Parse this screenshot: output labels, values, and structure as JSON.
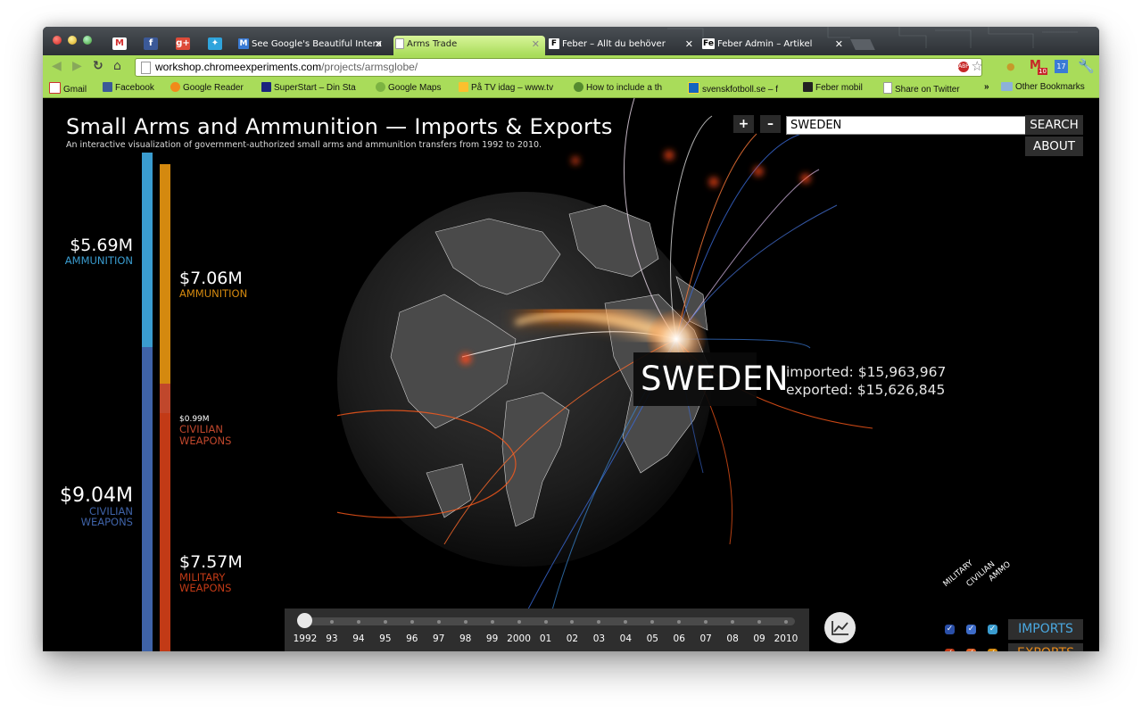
{
  "browser": {
    "tabs": [
      {
        "label": "See Google's Beautiful Intera",
        "favicon": "M"
      },
      {
        "label": "Arms Trade",
        "active": true
      },
      {
        "label": "Feber – Allt du behöver",
        "favicon": "F"
      },
      {
        "label": "Feber Admin – Artikel",
        "favicon": "Fe"
      }
    ],
    "url_host": "workshop.chromeexperiments.com",
    "url_path": "/projects/armsglobe/",
    "gmail_count": "10",
    "calendar_day": "17",
    "abp_label": "ABP",
    "bookmarks": [
      "Gmail",
      "Facebook",
      "Google Reader",
      "SuperStart – Din Sta",
      "Google Maps",
      "På TV idag – www.tv",
      "How to include a th",
      "svenskfotboll.se – f",
      "Feber mobil",
      "Share on Twitter"
    ],
    "bookmarks_overflow": "»",
    "other_bookmarks": "Other Bookmarks"
  },
  "page": {
    "title": "Small Arms and Ammunition — Imports & Exports",
    "subtitle": "An interactive visualization of government-authorized small arms and ammunition transfers from 1992 to 2010.",
    "search_value": "SWEDEN",
    "search_button": "SEARCH",
    "about_button": "ABOUT",
    "zoom_in": "+",
    "zoom_out": "–"
  },
  "imports_bar": {
    "ammunition_value": "$5.69M",
    "ammunition_label": "AMMUNITION",
    "civilian_value": "$9.04M",
    "civilian_label_1": "CIVILIAN",
    "civilian_label_2": "WEAPONS",
    "ammunition_fraction": 0.39,
    "civilian_fraction": 0.61
  },
  "exports_bar": {
    "ammunition_value": "$7.06M",
    "ammunition_label": "AMMUNITION",
    "civilian_value": "$0.99M",
    "civilian_label_1": "CIVILIAN",
    "civilian_label_2": "WEAPONS",
    "military_value": "$7.57M",
    "military_label_1": "MILITARY",
    "military_label_2": "WEAPONS",
    "ammunition_fraction": 0.45,
    "civilian_fraction": 0.06,
    "military_fraction": 0.49
  },
  "country_popup": {
    "name": "SWEDEN",
    "imported": "imported: $15,963,967",
    "exported": "exported: $15,626,845"
  },
  "timeline": {
    "years": [
      "1992",
      "93",
      "94",
      "95",
      "96",
      "97",
      "98",
      "99",
      "2000",
      "01",
      "02",
      "03",
      "04",
      "05",
      "06",
      "07",
      "08",
      "09",
      "2010"
    ],
    "selected": "1992"
  },
  "filters": {
    "columns": [
      "MILITARY",
      "CIVILIAN",
      "AMMO"
    ],
    "imports_label": "IMPORTS",
    "exports_label": "EXPORTS"
  },
  "colors": {
    "imports_ammo": "#3a9ccf",
    "imports_civilian": "#3f63a8",
    "exports_ammo": "#d4890f",
    "exports_civilian": "#c0472c",
    "exports_military": "#c23a16",
    "import_text": "#4aa8e0",
    "export_text": "#e88a1a"
  }
}
